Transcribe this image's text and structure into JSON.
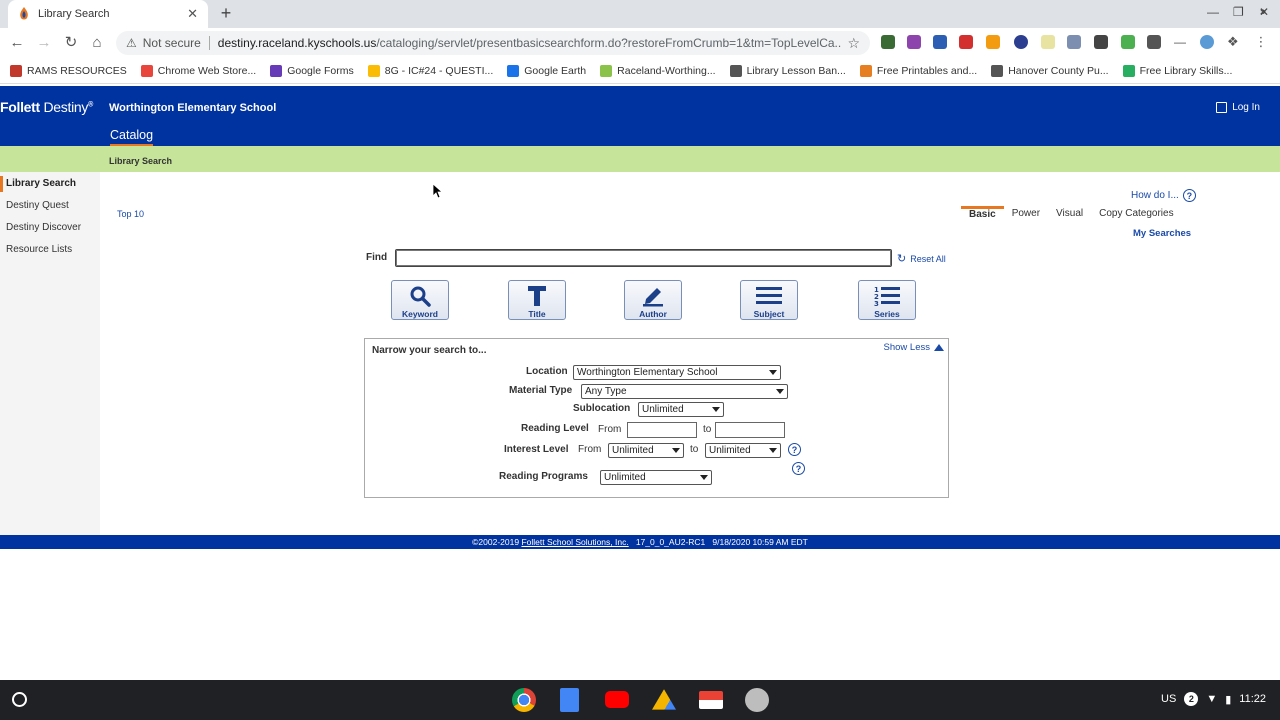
{
  "browser": {
    "tab_title": "Library Search",
    "new_tab": "+",
    "tab_close": "✕",
    "security_label": "Not secure",
    "url_host": "destiny.raceland.kyschools.us",
    "url_path": "/cataloging/servlet/presentbasicsearchform.do?restoreFromCrumb=1&tm=TopLevelCa...",
    "bookmarks": [
      {
        "label": "RAMS RESOURCES",
        "color": "#c0392b"
      },
      {
        "label": "Chrome Web Store...",
        "color": "#e8453c"
      },
      {
        "label": "Google Forms",
        "color": "#673ab7"
      },
      {
        "label": "8G - IC#24 - QUESTI...",
        "color": "#fbbc05"
      },
      {
        "label": "Google Earth",
        "color": "#1a73e8"
      },
      {
        "label": "Raceland-Worthing...",
        "color": "#8bc34a"
      },
      {
        "label": "Library Lesson Ban...",
        "color": "#555555"
      },
      {
        "label": "Free Printables and...",
        "color": "#e67e22"
      },
      {
        "label": "Hanover County Pu...",
        "color": "#555555"
      },
      {
        "label": "Free Library Skills...",
        "color": "#27ae60"
      }
    ],
    "bookmarks_more": "»"
  },
  "header": {
    "logo_bold": "Follett",
    "logo_light": " Destiny",
    "logo_mark": "®",
    "school": "Worthington Elementary School",
    "login": "Log In",
    "catalog_tab": "Catalog",
    "breadcrumb": "Library Search"
  },
  "sidebar": {
    "items": [
      {
        "label": "Library Search"
      },
      {
        "label": "Destiny Quest"
      },
      {
        "label": "Destiny Discover"
      },
      {
        "label": "Resource Lists"
      }
    ]
  },
  "main": {
    "top10": "Top 10",
    "how_do_i": "How do I...",
    "tabs": [
      {
        "label": "Basic"
      },
      {
        "label": "Power"
      },
      {
        "label": "Visual"
      },
      {
        "label": "Copy Categories"
      }
    ],
    "my_searches": "My Searches",
    "find_label": "Find",
    "find_value": "",
    "reset_all": "Reset All",
    "search_buttons": [
      {
        "label": "Keyword",
        "icon": "magnifier-icon"
      },
      {
        "label": "Title",
        "icon": "letter-t-icon"
      },
      {
        "label": "Author",
        "icon": "pencil-icon"
      },
      {
        "label": "Subject",
        "icon": "lines-icon"
      },
      {
        "label": "Series",
        "icon": "numbered-list-icon"
      }
    ]
  },
  "narrow": {
    "title": "Narrow your search to...",
    "show_less": "Show Less",
    "location_label": "Location",
    "location_value": "Worthington Elementary School",
    "material_label": "Material Type",
    "material_value": "Any Type",
    "sublocation_label": "Sublocation",
    "sublocation_value": "Unlimited",
    "reading_level_label": "Reading Level",
    "from": "From",
    "to": "to",
    "interest_label": "Interest Level",
    "interest_from_value": "Unlimited",
    "interest_to_value": "Unlimited",
    "programs_label": "Reading Programs",
    "programs_value": "Unlimited",
    "help": "?"
  },
  "footer": {
    "copyright": "©2002-2019",
    "company": "Follett School Solutions, Inc.",
    "version": "17_0_0_AU2-RC1",
    "datetime": "9/18/2020 10:59 AM EDT"
  },
  "taskbar": {
    "locale": "US",
    "notif_count": "2",
    "time": "11:22"
  }
}
